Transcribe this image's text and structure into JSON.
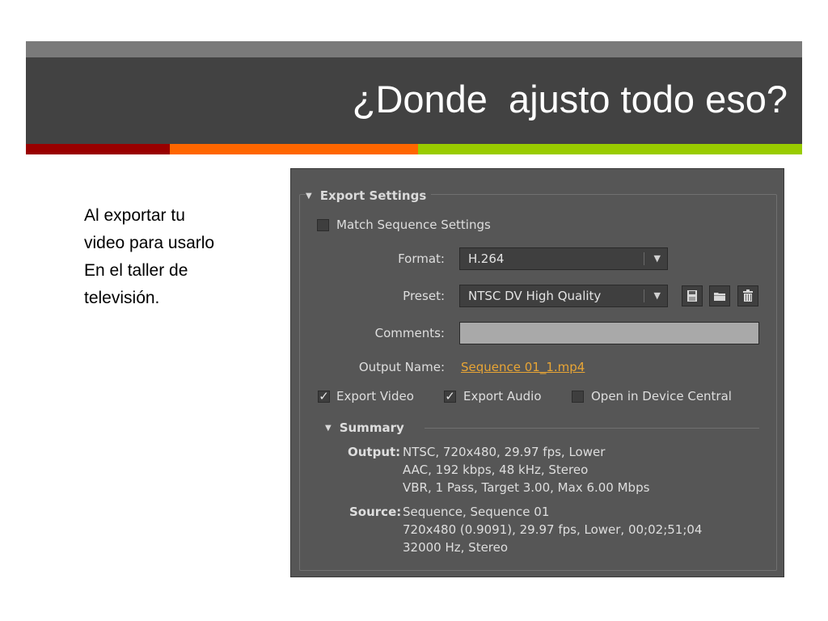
{
  "slide": {
    "title": "¿Donde  ajusto todo eso?",
    "body_lines": [
      "Al exportar tu",
      "video para usarlo",
      "En el taller de",
      "televisión."
    ]
  },
  "panel": {
    "section_title": "Export Settings",
    "match_sequence": {
      "label": "Match Sequence Settings",
      "checked": false
    },
    "format": {
      "label": "Format:",
      "value": "H.264"
    },
    "preset": {
      "label": "Preset:",
      "value": "NTSC DV High Quality"
    },
    "comments": {
      "label": "Comments:",
      "value": ""
    },
    "output_name": {
      "label": "Output Name:",
      "value": "Sequence 01_1.mp4"
    },
    "export_video": {
      "label": "Export Video",
      "checked": true
    },
    "export_audio": {
      "label": "Export Audio",
      "checked": true
    },
    "device_central": {
      "label": "Open in Device Central",
      "checked": false
    },
    "summary": {
      "title": "Summary",
      "output_label": "Output:",
      "output_lines": [
        "NTSC, 720x480, 29.97 fps, Lower",
        "AAC, 192 kbps, 48 kHz, Stereo",
        "VBR, 1 Pass, Target 3.00, Max 6.00 Mbps"
      ],
      "source_label": "Source:",
      "source_lines": [
        "Sequence, Sequence 01",
        "720x480 (0.9091), 29.97 fps, Lower, 00;02;51;04",
        "32000 Hz, Stereo"
      ]
    },
    "icons": [
      "save-preset-icon",
      "import-preset-icon",
      "delete-preset-icon",
      "dropdown-arrow-icon",
      "disclosure-triangle-icon"
    ]
  },
  "colors": {
    "title_bar": "#424242",
    "accent_red": "#990000",
    "accent_orange": "#ff6600",
    "accent_green": "#99cc00",
    "panel_bg": "#565656",
    "link": "#e8a535"
  }
}
